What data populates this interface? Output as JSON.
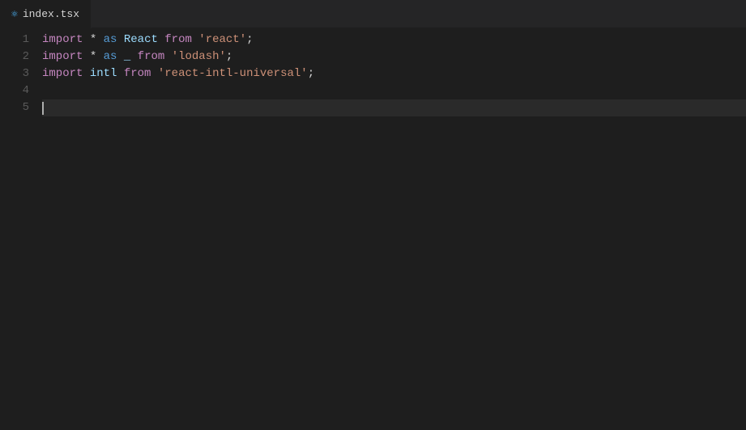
{
  "tab": {
    "icon": "⚛",
    "filename": "index.tsx"
  },
  "lines": [
    {
      "number": "1",
      "tokens": [
        {
          "type": "kw",
          "text": "import"
        },
        {
          "type": "punct",
          "text": " "
        },
        {
          "type": "op",
          "text": "*"
        },
        {
          "type": "punct",
          "text": " "
        },
        {
          "type": "kw-blue",
          "text": "as"
        },
        {
          "type": "punct",
          "text": " "
        },
        {
          "type": "ident",
          "text": "React"
        },
        {
          "type": "punct",
          "text": " "
        },
        {
          "type": "from-kw",
          "text": "from"
        },
        {
          "type": "punct",
          "text": " "
        },
        {
          "type": "str",
          "text": "'react'"
        },
        {
          "type": "punct",
          "text": ";"
        }
      ]
    },
    {
      "number": "2",
      "tokens": [
        {
          "type": "kw",
          "text": "import"
        },
        {
          "type": "punct",
          "text": " "
        },
        {
          "type": "op",
          "text": "*"
        },
        {
          "type": "punct",
          "text": " "
        },
        {
          "type": "kw-blue",
          "text": "as"
        },
        {
          "type": "punct",
          "text": " "
        },
        {
          "type": "ident",
          "text": "_"
        },
        {
          "type": "punct",
          "text": " "
        },
        {
          "type": "from-kw",
          "text": "from"
        },
        {
          "type": "punct",
          "text": " "
        },
        {
          "type": "str",
          "text": "'lodash'"
        },
        {
          "type": "punct",
          "text": ";"
        }
      ]
    },
    {
      "number": "3",
      "tokens": [
        {
          "type": "kw",
          "text": "import"
        },
        {
          "type": "punct",
          "text": " "
        },
        {
          "type": "ident",
          "text": "intl"
        },
        {
          "type": "punct",
          "text": " "
        },
        {
          "type": "from-kw",
          "text": "from"
        },
        {
          "type": "punct",
          "text": " "
        },
        {
          "type": "str",
          "text": "'react-intl-universal'"
        },
        {
          "type": "punct",
          "text": ";"
        }
      ]
    },
    {
      "number": "4",
      "tokens": []
    },
    {
      "number": "5",
      "tokens": [],
      "cursor": true
    }
  ],
  "colors": {
    "background": "#1e1e1e",
    "tab_active": "#1e1e1e",
    "line_number": "#5a5a5a",
    "cursor_line": "#2a2a2a"
  }
}
